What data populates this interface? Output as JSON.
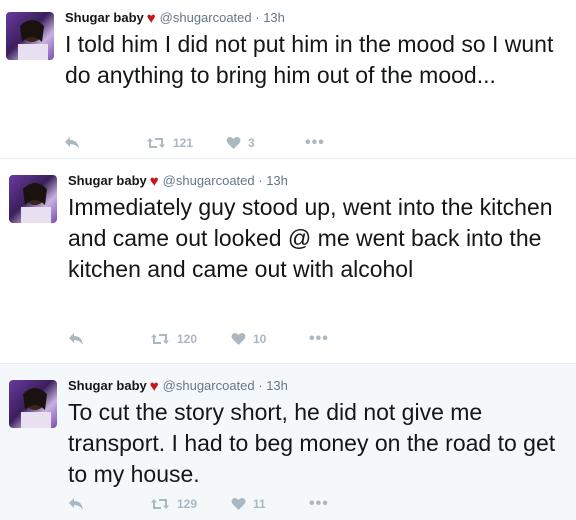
{
  "tweets": [
    {
      "user": {
        "name": "Shugar baby",
        "handle": "@shugarcoated",
        "time": "· 13h",
        "badge_icon": "heart-icon"
      },
      "text": "I told him I did not put him in the mood so I wunt do anything to bring him out of the mood...",
      "retweets": "121",
      "likes": "3"
    },
    {
      "user": {
        "name": "Shugar baby",
        "handle": "@shugarcoated",
        "time": "· 13h",
        "badge_icon": "heart-icon"
      },
      "text": "Immediately guy stood up, went into the kitchen and came out looked @ me went back into the kitchen and came out with alcohol",
      "retweets": "120",
      "likes": "10"
    },
    {
      "user": {
        "name": "Shugar baby",
        "handle": "@shugarcoated",
        "time": "· 13h",
        "badge_icon": "heart-icon"
      },
      "text": "To cut the story short, he did not give me transport.  I had to beg money on the road to get to my house.",
      "retweets": "129",
      "likes": "11"
    }
  ],
  "colors": {
    "heart": "#c4161c",
    "icon_gray": "#aab8c2",
    "meta_gray": "#657786",
    "highlight_bg": "#f5f8fa"
  },
  "icons": {
    "reply": "reply-icon",
    "retweet": "retweet-icon",
    "like": "like-heart-icon",
    "more": "more-dots-icon"
  }
}
